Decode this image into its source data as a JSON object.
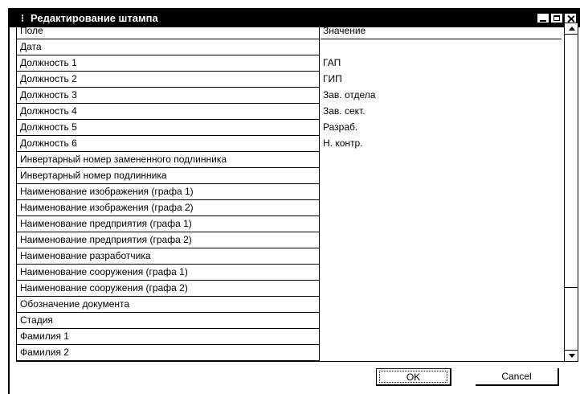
{
  "window": {
    "title": "Редактирование штампа",
    "app_icon": "dialog-icon"
  },
  "grid": {
    "headers": {
      "field": "Поле",
      "value": "Значение"
    },
    "rows": [
      {
        "field": "Дата",
        "value": ""
      },
      {
        "field": "Должность 1",
        "value": "ГАП"
      },
      {
        "field": "Должность 2",
        "value": "ГИП"
      },
      {
        "field": "Должность 3",
        "value": "Зав. отдела"
      },
      {
        "field": "Должность 4",
        "value": "Зав. сект."
      },
      {
        "field": "Должность 5",
        "value": "Разраб."
      },
      {
        "field": "Должность 6",
        "value": "Н. контр."
      },
      {
        "field": "Инвертарный номер замененного подлинника",
        "value": ""
      },
      {
        "field": "Инвертарный номер подлинника",
        "value": ""
      },
      {
        "field": "Наименование изображения (графа 1)",
        "value": ""
      },
      {
        "field": "Наименование изображения (графа 2)",
        "value": ""
      },
      {
        "field": "Наименование предприятия (графа 1)",
        "value": ""
      },
      {
        "field": "Наименование предприятия (графа 2)",
        "value": ""
      },
      {
        "field": "Наименование разработчика",
        "value": ""
      },
      {
        "field": "Наименование сооружения (графа 1)",
        "value": ""
      },
      {
        "field": "Наименование сооружения (графа 2)",
        "value": ""
      },
      {
        "field": "Обозначение документа",
        "value": ""
      },
      {
        "field": "Стадия",
        "value": ""
      },
      {
        "field": "Фамилия 1",
        "value": ""
      },
      {
        "field": "Фамилия 2",
        "value": ""
      }
    ]
  },
  "buttons": {
    "ok": "OK",
    "cancel": "Cancel"
  }
}
